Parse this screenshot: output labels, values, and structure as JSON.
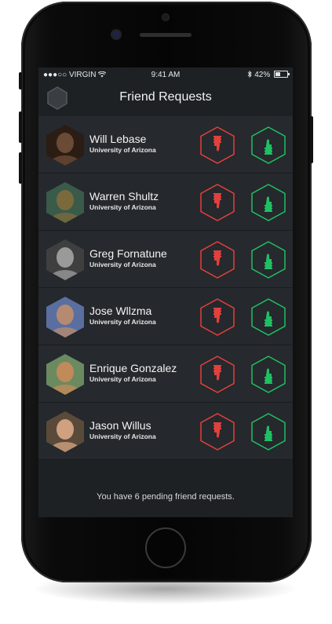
{
  "status_bar": {
    "carrier": "●●●○○ VIRGIN",
    "time": "9:41 AM",
    "battery": "42%"
  },
  "header": {
    "title": "Friend Requests"
  },
  "requests": [
    {
      "name": "Will Lebase",
      "school": "University of Arizona"
    },
    {
      "name": "Warren Shultz",
      "school": "University of Arizona"
    },
    {
      "name": "Greg Fornatune",
      "school": "University of Arizona"
    },
    {
      "name": "Jose Wllzma",
      "school": "University of Arizona"
    },
    {
      "name": "Enrique Gonzalez",
      "school": "University of Arizona"
    },
    {
      "name": "Jason Willus",
      "school": "University of Arizona"
    }
  ],
  "footer": {
    "message": "You have 6 pending friend requests."
  },
  "colors": {
    "reject": "#e0413c",
    "accept": "#1fbf62",
    "screen_bg": "#1e2124",
    "row_bg": "#25282c"
  },
  "icons": {
    "reject": "thumbs-down-icon",
    "accept": "thumbs-up-icon",
    "menu": "hexagon-icon"
  }
}
